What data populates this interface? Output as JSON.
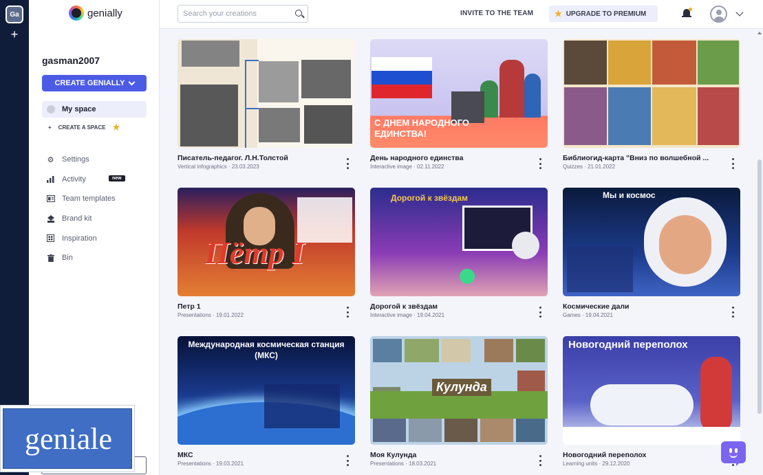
{
  "rail": {
    "workspace_initials": "Ga",
    "add_label": "+"
  },
  "brand": {
    "name": "genially"
  },
  "sidebar": {
    "username": "gasman2007",
    "create_button": "CREATE GENIALLY",
    "my_space": "My space",
    "create_space": "CREATE A SPACE",
    "nav": [
      {
        "label": "Settings",
        "icon": "gear-icon"
      },
      {
        "label": "Activity",
        "icon": "activity-icon",
        "badge": "new"
      },
      {
        "label": "Team templates",
        "icon": "templates-icon"
      },
      {
        "label": "Brand kit",
        "icon": "brand-kit-icon"
      },
      {
        "label": "Inspiration",
        "icon": "inspiration-icon"
      },
      {
        "label": "Bin",
        "icon": "bin-icon"
      }
    ]
  },
  "topbar": {
    "search_placeholder": "Search your creations",
    "invite": "INVITE TO THE TEAM",
    "upgrade": "UPGRADE TO PREMIUM"
  },
  "cards": [
    {
      "title": "Писатель-педагог. Л.Н.Толстой",
      "type": "Vertical infographics",
      "date": "23.03.2023",
      "overlay": ""
    },
    {
      "title": "День народного единства",
      "type": "Interactive image",
      "date": "02.11.2022",
      "overlay": "С ДНЕМ НАРОДНОГО ЕДИНСТВА!"
    },
    {
      "title": "Библиогид-карта \"Вниз по волшебной ...",
      "type": "Quizzes",
      "date": "21.01.2022",
      "overlay": ""
    },
    {
      "title": "Петр 1",
      "type": "Presentations",
      "date": "19.01.2022",
      "overlay": "Пётр I"
    },
    {
      "title": "Дорогой к звёздам",
      "type": "Interactive image",
      "date": "19.04.2021",
      "overlay": "Дорогой к звёздам"
    },
    {
      "title": "Космические дали",
      "type": "Games",
      "date": "19.04.2021",
      "overlay": "Мы и космос"
    },
    {
      "title": "МКС",
      "type": "Presentations",
      "date": "19.03.2021",
      "overlay": "Международная космическая станция (МКС)"
    },
    {
      "title": "Моя Кулунда",
      "type": "Presentations",
      "date": "18.03.2021",
      "overlay": "Кулунда"
    },
    {
      "title": "Новогодний переполох",
      "type": "Learning units",
      "date": "29.12.2020",
      "overlay": "Новогодний переполох"
    }
  ],
  "overlay_box": {
    "text": "geniale"
  },
  "colors": {
    "accent": "#4b5be6",
    "rail": "#0f1d3a",
    "star": "#f2b01e",
    "chat": "#7b64f0"
  }
}
